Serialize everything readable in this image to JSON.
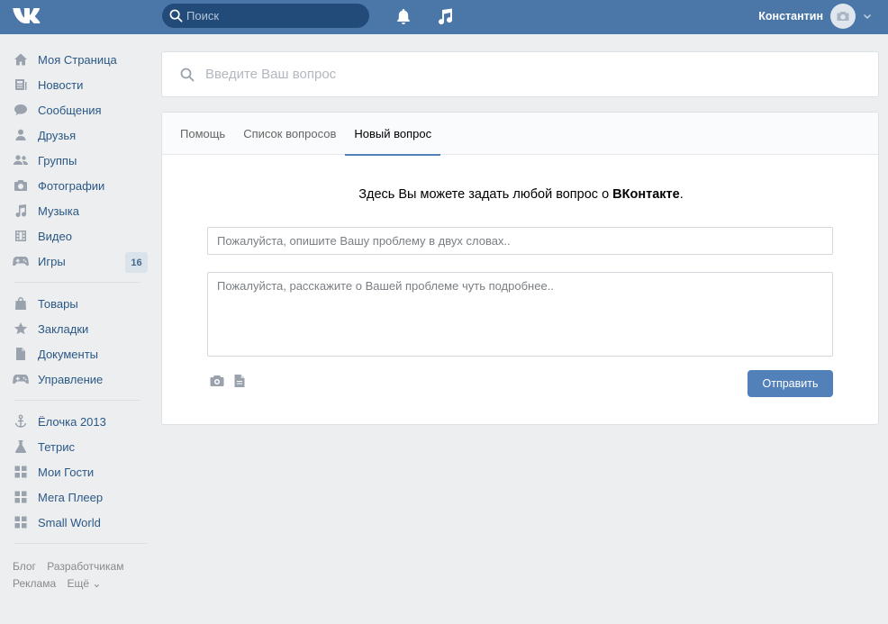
{
  "header": {
    "search_placeholder": "Поиск",
    "user_name": "Константин"
  },
  "sidebar": {
    "groups": [
      [
        {
          "label": "Моя Страница",
          "icon": "home-icon"
        },
        {
          "label": "Новости",
          "icon": "news-icon"
        },
        {
          "label": "Сообщения",
          "icon": "messages-icon"
        },
        {
          "label": "Друзья",
          "icon": "friends-icon"
        },
        {
          "label": "Группы",
          "icon": "groups-icon"
        },
        {
          "label": "Фотографии",
          "icon": "camera-icon"
        },
        {
          "label": "Музыка",
          "icon": "music-icon"
        },
        {
          "label": "Видео",
          "icon": "video-icon"
        },
        {
          "label": "Игры",
          "icon": "gamepad-icon",
          "badge": "16"
        }
      ],
      [
        {
          "label": "Товары",
          "icon": "bag-icon"
        },
        {
          "label": "Закладки",
          "icon": "star-icon"
        },
        {
          "label": "Документы",
          "icon": "document-icon"
        },
        {
          "label": "Управление",
          "icon": "gamepad-icon"
        }
      ],
      [
        {
          "label": "Ёлочка 2013",
          "icon": "anchor-icon"
        },
        {
          "label": "Тетрис",
          "icon": "flask-icon"
        },
        {
          "label": "Мои Гости",
          "icon": "app-grid-icon"
        },
        {
          "label": "Мега Плеер",
          "icon": "app-grid-icon"
        },
        {
          "label": "Small World",
          "icon": "app-grid-icon"
        }
      ]
    ],
    "footer": {
      "blog": "Блог",
      "developers": "Разработчикам",
      "ads": "Реклама",
      "more": "Ещё ⌄"
    }
  },
  "question_search": {
    "placeholder": "Введите Ваш вопрос"
  },
  "tabs": [
    {
      "label": "Помощь",
      "active": false
    },
    {
      "label": "Список вопросов",
      "active": false
    },
    {
      "label": "Новый вопрос",
      "active": true
    }
  ],
  "form": {
    "intro_text": "Здесь Вы можете задать любой вопрос о ",
    "intro_brand": "ВКонтакте",
    "intro_end": ".",
    "title_placeholder": "Пожалуйста, опишите Вашу проблему в двух словах..",
    "body_placeholder": "Пожалуйста, расскажите о Вашей проблеме чуть подробнее..",
    "submit_label": "Отправить"
  },
  "colors": {
    "header": "#4a76a8",
    "link": "#2a5885",
    "accent": "#5181b8",
    "icon": "#99a2ad"
  }
}
